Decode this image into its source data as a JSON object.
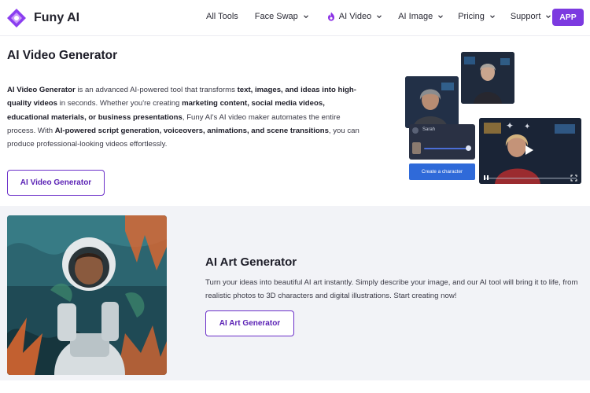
{
  "brand": {
    "name": "Funy AI",
    "accent": "#7c3ae0"
  },
  "nav": {
    "items": [
      {
        "label": "All Tools",
        "has_dropdown": false
      },
      {
        "label": "Face Swap",
        "has_dropdown": true
      },
      {
        "label": "AI Video",
        "has_dropdown": true,
        "icon": "flame-icon"
      },
      {
        "label": "AI Image",
        "has_dropdown": true
      },
      {
        "label": "Pricing",
        "has_dropdown": true
      },
      {
        "label": "Support",
        "has_dropdown": true
      }
    ],
    "app_button": "APP"
  },
  "video_section": {
    "title": "AI Video Generator",
    "desc": {
      "p1": "AI Video Generator",
      "p2": " is an advanced AI-powered tool that transforms ",
      "p3": "text, images, and ideas into high-quality videos",
      "p4": " in seconds. Whether you're creating ",
      "p5": "marketing content, social media videos, educational materials, or business presentations",
      "p6": ", Funy AI's AI video maker automates the entire process. With ",
      "p7": "AI-powered script generation, voiceovers, animations, and scene transitions",
      "p8": ", you can produce professional-looking videos effortlessly."
    },
    "button": "AI Video Generator",
    "collage": {
      "panel_name": "Sarah",
      "create_button": "Create a character"
    }
  },
  "art_section": {
    "title": "AI Art Generator",
    "desc": "Turn your ideas into beautiful AI art instantly. Simply describe your image, and our AI tool will bring it to life, from realistic photos to 3D characters and digital illustrations. Start creating now!",
    "button": "AI Art Generator"
  }
}
